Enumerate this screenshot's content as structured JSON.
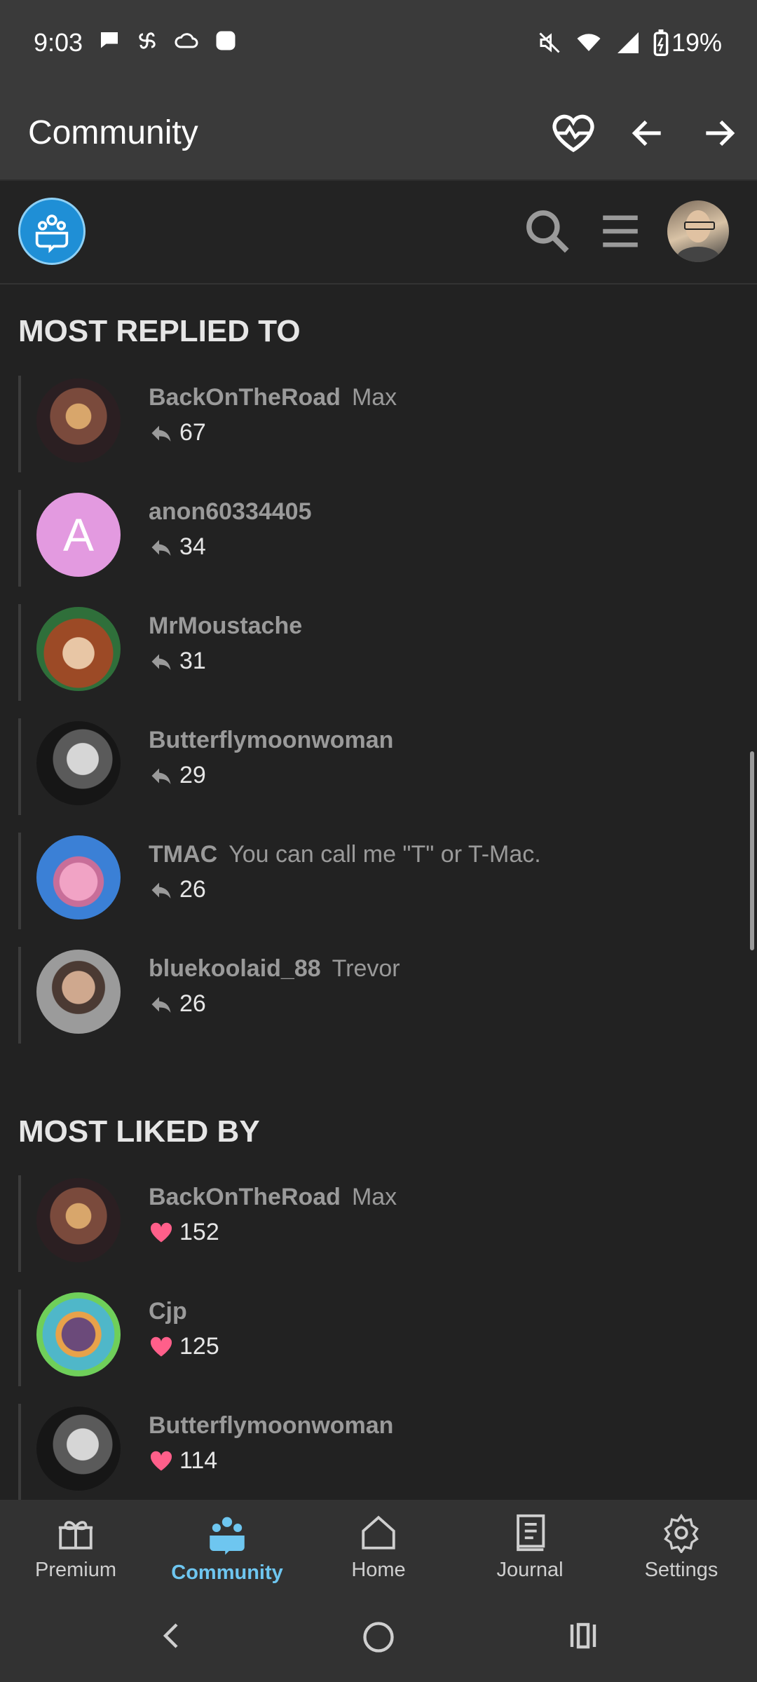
{
  "status_bar": {
    "time": "9:03",
    "battery": "19%",
    "icons_left": [
      "chat-icon",
      "pinwheel-icon",
      "cloud-icon",
      "square-app-icon"
    ],
    "icons_right": [
      "mute-icon",
      "wifi-icon",
      "signal-icon",
      "battery-icon"
    ]
  },
  "app_bar": {
    "title": "Community",
    "actions": [
      "heart-pulse-icon",
      "arrow-left-icon",
      "arrow-right-icon"
    ]
  },
  "forum_header": {
    "logo": "community-logo",
    "tools": [
      "search-icon",
      "menu-icon",
      "user-avatar"
    ]
  },
  "most_replied": {
    "title": "MOST REPLIED TO",
    "items": [
      {
        "username": "BackOnTheRoad",
        "subtitle": "Max",
        "count": "67"
      },
      {
        "username": "anon60334405",
        "subtitle": "",
        "count": "34",
        "initial": "A"
      },
      {
        "username": "MrMoustache",
        "subtitle": "",
        "count": "31"
      },
      {
        "username": "Butterflymoonwoman",
        "subtitle": "",
        "count": "29"
      },
      {
        "username": "TMAC",
        "subtitle": "You can call me \"T\" or T-Mac.",
        "count": "26"
      },
      {
        "username": "bluekoolaid_88",
        "subtitle": "Trevor",
        "count": "26"
      }
    ]
  },
  "most_liked": {
    "title": "MOST LIKED BY",
    "items": [
      {
        "username": "BackOnTheRoad",
        "subtitle": "Max",
        "count": "152"
      },
      {
        "username": "Cjp",
        "subtitle": "",
        "count": "125"
      },
      {
        "username": "Butterflymoonwoman",
        "subtitle": "",
        "count": "114"
      }
    ]
  },
  "bottom_nav": [
    {
      "label": "Premium",
      "icon": "gift-icon"
    },
    {
      "label": "Community",
      "icon": "community-icon",
      "active": true
    },
    {
      "label": "Home",
      "icon": "home-icon"
    },
    {
      "label": "Journal",
      "icon": "journal-icon"
    },
    {
      "label": "Settings",
      "icon": "gear-icon"
    }
  ],
  "colors": {
    "background": "#222222",
    "bar": "#3a3a3a",
    "accent": "#6ec6f0",
    "heart": "#ff5f8a"
  }
}
